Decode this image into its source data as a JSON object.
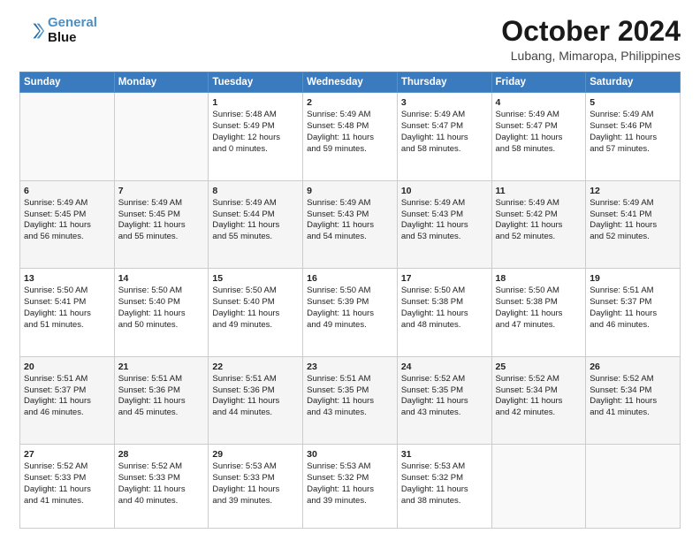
{
  "header": {
    "logo_line1": "General",
    "logo_line2": "Blue",
    "title": "October 2024",
    "subtitle": "Lubang, Mimaropa, Philippines"
  },
  "days_of_week": [
    "Sunday",
    "Monday",
    "Tuesday",
    "Wednesday",
    "Thursday",
    "Friday",
    "Saturday"
  ],
  "weeks": [
    [
      {
        "day": "",
        "info": ""
      },
      {
        "day": "",
        "info": ""
      },
      {
        "day": "1",
        "info": "Sunrise: 5:48 AM\nSunset: 5:49 PM\nDaylight: 12 hours\nand 0 minutes."
      },
      {
        "day": "2",
        "info": "Sunrise: 5:49 AM\nSunset: 5:48 PM\nDaylight: 11 hours\nand 59 minutes."
      },
      {
        "day": "3",
        "info": "Sunrise: 5:49 AM\nSunset: 5:47 PM\nDaylight: 11 hours\nand 58 minutes."
      },
      {
        "day": "4",
        "info": "Sunrise: 5:49 AM\nSunset: 5:47 PM\nDaylight: 11 hours\nand 58 minutes."
      },
      {
        "day": "5",
        "info": "Sunrise: 5:49 AM\nSunset: 5:46 PM\nDaylight: 11 hours\nand 57 minutes."
      }
    ],
    [
      {
        "day": "6",
        "info": "Sunrise: 5:49 AM\nSunset: 5:45 PM\nDaylight: 11 hours\nand 56 minutes."
      },
      {
        "day": "7",
        "info": "Sunrise: 5:49 AM\nSunset: 5:45 PM\nDaylight: 11 hours\nand 55 minutes."
      },
      {
        "day": "8",
        "info": "Sunrise: 5:49 AM\nSunset: 5:44 PM\nDaylight: 11 hours\nand 55 minutes."
      },
      {
        "day": "9",
        "info": "Sunrise: 5:49 AM\nSunset: 5:43 PM\nDaylight: 11 hours\nand 54 minutes."
      },
      {
        "day": "10",
        "info": "Sunrise: 5:49 AM\nSunset: 5:43 PM\nDaylight: 11 hours\nand 53 minutes."
      },
      {
        "day": "11",
        "info": "Sunrise: 5:49 AM\nSunset: 5:42 PM\nDaylight: 11 hours\nand 52 minutes."
      },
      {
        "day": "12",
        "info": "Sunrise: 5:49 AM\nSunset: 5:41 PM\nDaylight: 11 hours\nand 52 minutes."
      }
    ],
    [
      {
        "day": "13",
        "info": "Sunrise: 5:50 AM\nSunset: 5:41 PM\nDaylight: 11 hours\nand 51 minutes."
      },
      {
        "day": "14",
        "info": "Sunrise: 5:50 AM\nSunset: 5:40 PM\nDaylight: 11 hours\nand 50 minutes."
      },
      {
        "day": "15",
        "info": "Sunrise: 5:50 AM\nSunset: 5:40 PM\nDaylight: 11 hours\nand 49 minutes."
      },
      {
        "day": "16",
        "info": "Sunrise: 5:50 AM\nSunset: 5:39 PM\nDaylight: 11 hours\nand 49 minutes."
      },
      {
        "day": "17",
        "info": "Sunrise: 5:50 AM\nSunset: 5:38 PM\nDaylight: 11 hours\nand 48 minutes."
      },
      {
        "day": "18",
        "info": "Sunrise: 5:50 AM\nSunset: 5:38 PM\nDaylight: 11 hours\nand 47 minutes."
      },
      {
        "day": "19",
        "info": "Sunrise: 5:51 AM\nSunset: 5:37 PM\nDaylight: 11 hours\nand 46 minutes."
      }
    ],
    [
      {
        "day": "20",
        "info": "Sunrise: 5:51 AM\nSunset: 5:37 PM\nDaylight: 11 hours\nand 46 minutes."
      },
      {
        "day": "21",
        "info": "Sunrise: 5:51 AM\nSunset: 5:36 PM\nDaylight: 11 hours\nand 45 minutes."
      },
      {
        "day": "22",
        "info": "Sunrise: 5:51 AM\nSunset: 5:36 PM\nDaylight: 11 hours\nand 44 minutes."
      },
      {
        "day": "23",
        "info": "Sunrise: 5:51 AM\nSunset: 5:35 PM\nDaylight: 11 hours\nand 43 minutes."
      },
      {
        "day": "24",
        "info": "Sunrise: 5:52 AM\nSunset: 5:35 PM\nDaylight: 11 hours\nand 43 minutes."
      },
      {
        "day": "25",
        "info": "Sunrise: 5:52 AM\nSunset: 5:34 PM\nDaylight: 11 hours\nand 42 minutes."
      },
      {
        "day": "26",
        "info": "Sunrise: 5:52 AM\nSunset: 5:34 PM\nDaylight: 11 hours\nand 41 minutes."
      }
    ],
    [
      {
        "day": "27",
        "info": "Sunrise: 5:52 AM\nSunset: 5:33 PM\nDaylight: 11 hours\nand 41 minutes."
      },
      {
        "day": "28",
        "info": "Sunrise: 5:52 AM\nSunset: 5:33 PM\nDaylight: 11 hours\nand 40 minutes."
      },
      {
        "day": "29",
        "info": "Sunrise: 5:53 AM\nSunset: 5:33 PM\nDaylight: 11 hours\nand 39 minutes."
      },
      {
        "day": "30",
        "info": "Sunrise: 5:53 AM\nSunset: 5:32 PM\nDaylight: 11 hours\nand 39 minutes."
      },
      {
        "day": "31",
        "info": "Sunrise: 5:53 AM\nSunset: 5:32 PM\nDaylight: 11 hours\nand 38 minutes."
      },
      {
        "day": "",
        "info": ""
      },
      {
        "day": "",
        "info": ""
      }
    ]
  ]
}
